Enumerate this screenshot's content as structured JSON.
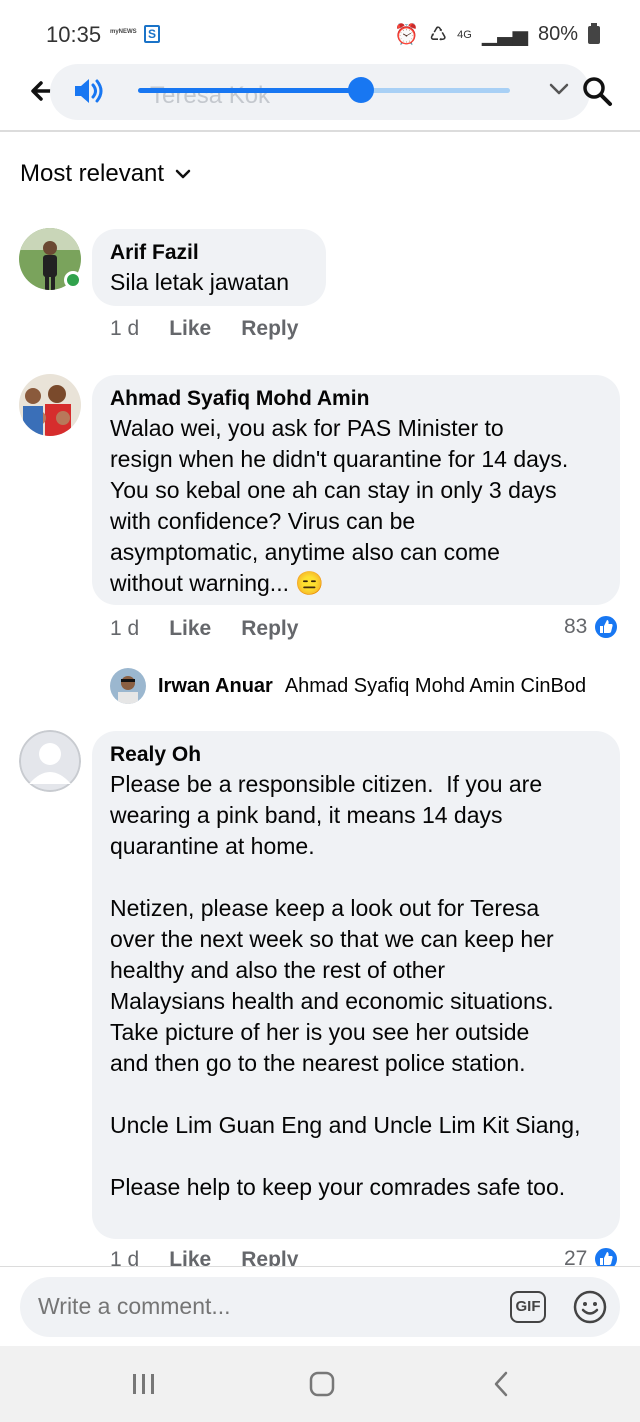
{
  "status": {
    "time": "10:35",
    "news_label": "myNEWS",
    "network": "4G",
    "battery": "80%"
  },
  "header": {
    "search_text": "Teresa Kok",
    "volume_level": 0.6
  },
  "sort": {
    "label": "Most relevant"
  },
  "comments": [
    {
      "author": "Arif Fazil",
      "text": "Sila letak jawatan",
      "time": "1 d",
      "like_label": "Like",
      "reply_label": "Reply"
    },
    {
      "author": "Ahmad Syafiq Mohd Amin",
      "text": "Walao wei, you ask for PAS Minister to\nresign when he didn't quarantine for 14 days.\nYou so kebal one ah can stay in only 3 days\nwith confidence? Virus can be\nasymptomatic, anytime also can come\nwithout warning... 😑",
      "time": "1 d",
      "like_label": "Like",
      "reply_label": "Reply",
      "reactions": "83"
    },
    {
      "author": "Realy Oh",
      "text": "Please be a responsible citizen.  If you are\nwearing a pink band, it means 14 days\nquarantine at home.\n\nNetizen, please keep a look out for Teresa\nover the next week so that we can keep her\nhealthy and also the rest of other\nMalaysians health and economic situations.\nTake picture of her is you see her outside\nand then go to the nearest police station.\n\nUncle Lim Guan Eng and Uncle Lim Kit Siang,\n\nPlease help to keep your comrades safe too.",
      "time": "1 d",
      "like_label": "Like",
      "reply_label": "Reply",
      "reactions": "27"
    }
  ],
  "reply_preview": {
    "author": "Irwan Anuar",
    "text": "Ahmad Syafiq Mohd Amin CinBod"
  },
  "composer": {
    "placeholder": "Write a comment...",
    "gif_label": "GIF"
  },
  "colors": {
    "accent": "#1877f2",
    "bubble": "#f0f2f5",
    "online": "#31a24c"
  }
}
